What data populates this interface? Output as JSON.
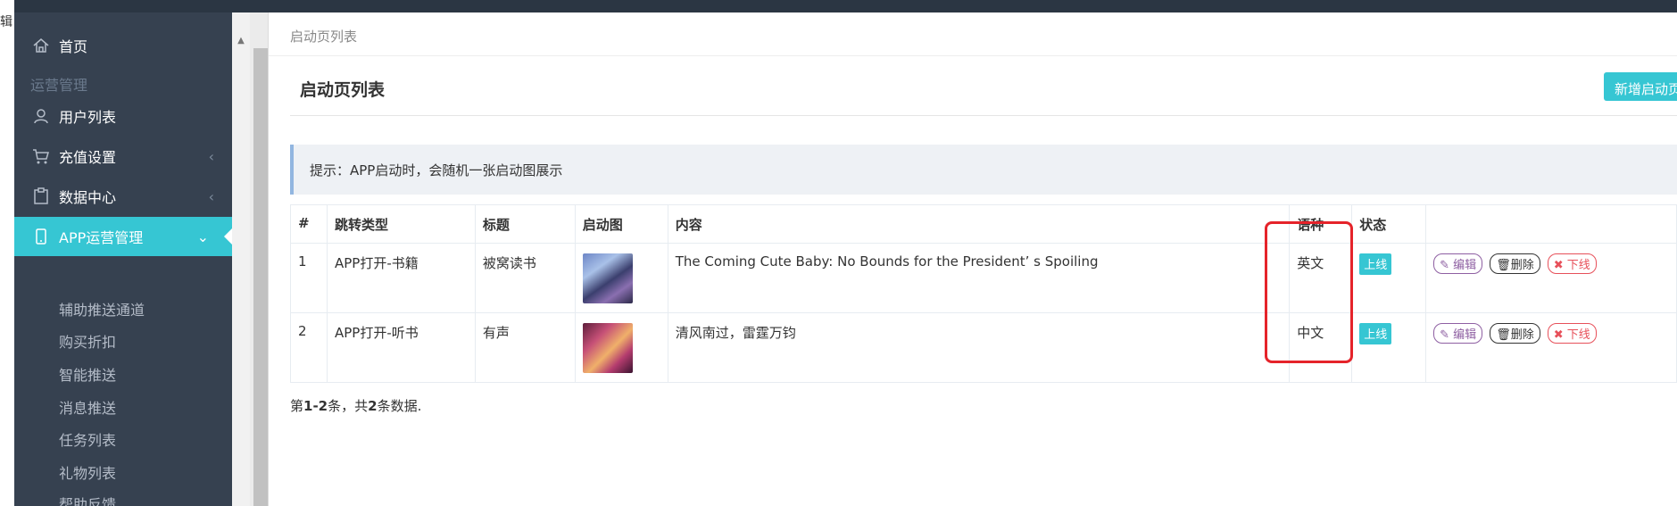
{
  "topbar": {
    "left_glyph": "辑"
  },
  "sidebar": {
    "home": "首页",
    "section_ops": "运营管理",
    "items": [
      {
        "label": "用户列表",
        "icon": "user-icon"
      },
      {
        "label": "充值设置",
        "icon": "cart-icon"
      },
      {
        "label": "数据中心",
        "icon": "clipboard-icon"
      },
      {
        "label": "APP运营管理",
        "icon": "mobile-icon"
      }
    ],
    "sub_items": [
      "辅助推送通道",
      "购买折扣",
      "智能推送",
      "消息推送",
      "任务列表",
      "礼物列表",
      "帮助反馈"
    ]
  },
  "breadcrumb": "启动页列表",
  "page": {
    "title": "启动页列表",
    "add_button": "新增启动页",
    "tip": "提示：APP启动时，会随机一张启动图展示"
  },
  "table": {
    "headers": [
      "#",
      "跳转类型",
      "标题",
      "启动图",
      "内容",
      "语种",
      "状态",
      ""
    ],
    "rows": [
      {
        "no": "1",
        "type": "APP打开-书籍",
        "title": "被窝读书",
        "content": "The Coming Cute Baby: No Bounds for the President’ s Spoiling",
        "lang": "英文",
        "status": "上线"
      },
      {
        "no": "2",
        "type": "APP打开-听书",
        "title": "有声",
        "content": "清风南过，雷霆万钧",
        "lang": "中文",
        "status": "上线"
      }
    ],
    "actions": {
      "edit": "编辑",
      "delete": "删除",
      "offline": "下线"
    }
  },
  "pager": {
    "prefix": "第",
    "range": "1-2",
    "mid": "条，共",
    "total": "2",
    "suffix": "条数据."
  },
  "colors": {
    "sidebar": "#364150",
    "accent": "#36c6d3",
    "highlight": "#e5232a"
  }
}
